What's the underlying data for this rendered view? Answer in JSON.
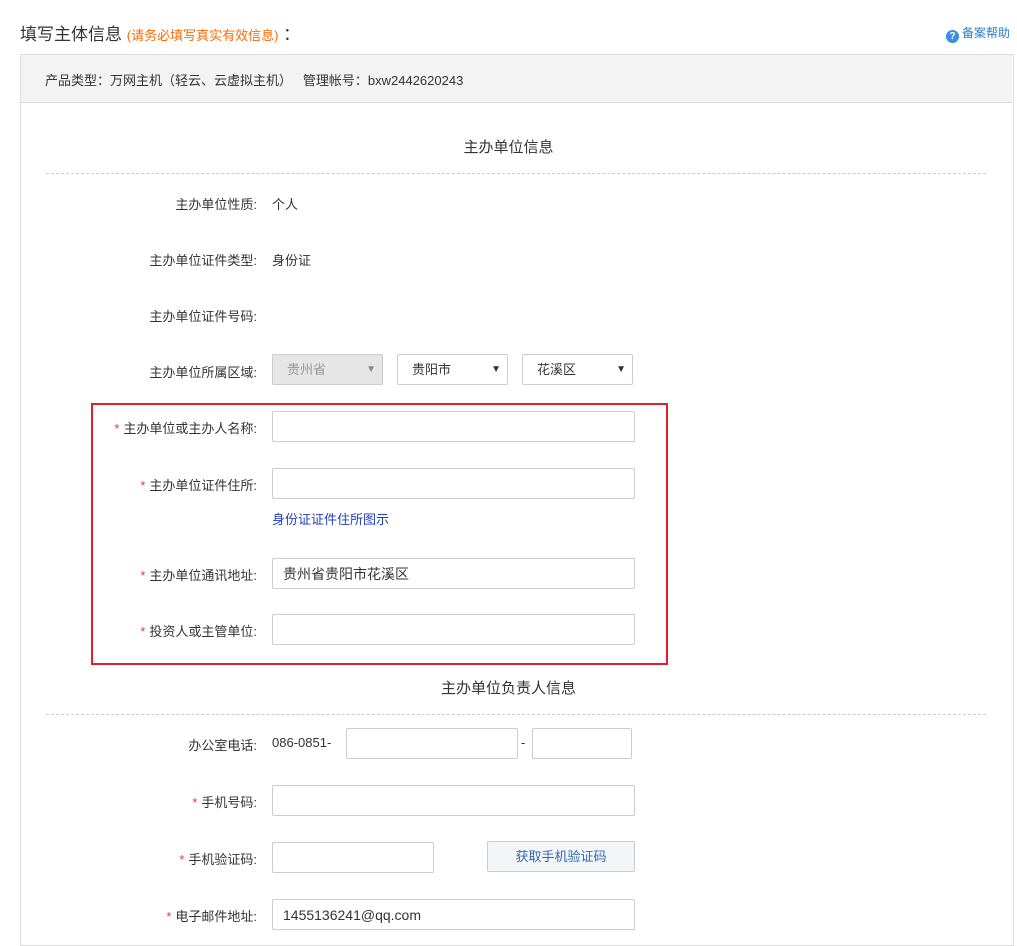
{
  "header": {
    "title": "填写主体信息",
    "warning": "(请务必填写真实有效信息)",
    "colon": "：",
    "help_label": "备案帮助"
  },
  "product": {
    "type_label": "产品类型：",
    "type_value": "万网主机（轻云、云虚拟主机）",
    "account_label": "管理帐号：",
    "account_value": "bxw2442620243"
  },
  "sections": {
    "unit_info": "主办单位信息",
    "person_info": "主办单位负责人信息"
  },
  "unit": {
    "nature_label": "主办单位性质:",
    "nature_value": "个人",
    "cert_type_label": "主办单位证件类型:",
    "cert_type_value": "身份证",
    "cert_no_label": "主办单位证件号码:",
    "region_label": "主办单位所属区域:",
    "province": "贵州省",
    "city": "贵阳市",
    "district": "花溪区",
    "name_label": "主办单位或主办人名称:",
    "name_value": "",
    "cert_addr_label": "主办单位证件住所:",
    "cert_addr_value": "",
    "cert_addr_link": "身份证证件住所图示",
    "mail_addr_label": "主办单位通讯地址:",
    "mail_addr_value": "贵州省贵阳市花溪区",
    "investor_label": "投资人或主管单位:",
    "investor_value": ""
  },
  "person": {
    "phone_label": "办公室电话:",
    "phone_prefix": "086-0851-",
    "phone_sep": "-",
    "phone_main": "",
    "phone_ext": "",
    "mobile_label": "手机号码:",
    "mobile_value": "",
    "code_label": "手机验证码:",
    "code_value": "",
    "get_code_button": "获取手机验证码",
    "email_label": "电子邮件地址:",
    "email_value": "1455136241@qq.com"
  },
  "required_mark": "*",
  "caret": "▼",
  "colors": {
    "warning": "#ff6a00",
    "required": "#e4393c",
    "highlight_border": "#e0202a",
    "link": "#2040c0"
  }
}
